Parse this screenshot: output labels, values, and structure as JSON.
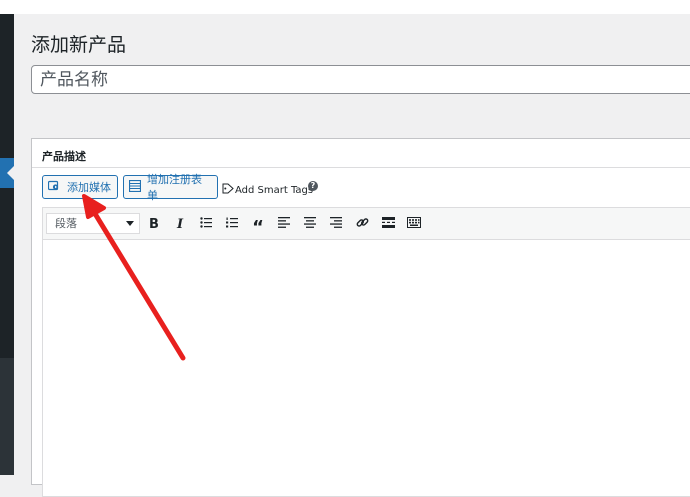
{
  "page": {
    "title": "添加新产品",
    "product_name_placeholder": "产品名称"
  },
  "description_box": {
    "title": "产品描述",
    "add_media_label": "添加媒体",
    "add_form_label": "增加注册表单",
    "smart_tags_label": "Add Smart Tags",
    "help_glyph": "?"
  },
  "editor": {
    "format_selected": "段落",
    "tools": [
      {
        "name": "bold",
        "glyph": "B"
      },
      {
        "name": "italic",
        "glyph": "I"
      },
      {
        "name": "bulleted-list",
        "icon": "bulleted-list-icon"
      },
      {
        "name": "numbered-list",
        "icon": "numbered-list-icon"
      },
      {
        "name": "blockquote",
        "glyph": "“"
      },
      {
        "name": "align-left",
        "icon": "align-left-icon"
      },
      {
        "name": "align-center",
        "icon": "align-center-icon"
      },
      {
        "name": "align-right",
        "icon": "align-right-icon"
      },
      {
        "name": "link",
        "icon": "link-icon"
      },
      {
        "name": "read-more",
        "icon": "read-more-icon"
      },
      {
        "name": "toolbar-toggle",
        "icon": "keyboard-icon"
      }
    ]
  },
  "colors": {
    "accent": "#2271b1",
    "annotation_arrow": "#e8201e",
    "sidebar": "#1d2327"
  }
}
